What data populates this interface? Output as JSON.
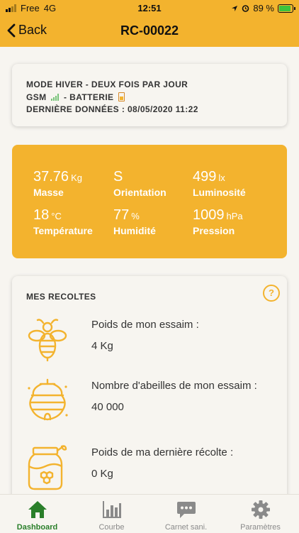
{
  "status_bar": {
    "carrier": "Free",
    "network": "4G",
    "time": "12:51",
    "battery_percent": "89 %",
    "battery_level": 0.89
  },
  "nav": {
    "back_label": "Back",
    "title": "RC-00022"
  },
  "info": {
    "mode": "MODE HIVER - DEUX FOIS PAR JOUR",
    "gsm_label": "GSM",
    "battery_label": "- BATTERIE",
    "last_data": "DERNIÈRE DONNÉES : 08/05/2020 11:22"
  },
  "metrics": [
    {
      "value": "37.76",
      "unit": "Kg",
      "label": "Masse"
    },
    {
      "value": "S",
      "unit": "",
      "label": "Orientation"
    },
    {
      "value": "499",
      "unit": "lx",
      "label": "Luminosité"
    },
    {
      "value": "18",
      "unit": "°C",
      "label": "Température"
    },
    {
      "value": "77",
      "unit": "%",
      "label": "Humidité"
    },
    {
      "value": "1009",
      "unit": "hPa",
      "label": "Pression"
    }
  ],
  "harvests": {
    "title": "MES RECOLTES",
    "help_label": "?",
    "items": [
      {
        "icon": "bee-icon",
        "label": "Poids de mon essaim :",
        "value": "4 Kg"
      },
      {
        "icon": "beehive-icon",
        "label": "Nombre d'abeilles de mon essaim :",
        "value": "40 000"
      },
      {
        "icon": "honey-jar-icon",
        "label": "Poids de ma dernière récolte :",
        "value": "0 Kg"
      }
    ]
  },
  "tabs": [
    {
      "label": "Dashboard",
      "icon": "home-icon",
      "active": true
    },
    {
      "label": "Courbe",
      "icon": "bar-chart-icon",
      "active": false
    },
    {
      "label": "Carnet sani.",
      "icon": "chat-icon",
      "active": false
    },
    {
      "label": "Paramètres",
      "icon": "gear-icon",
      "active": false
    }
  ],
  "colors": {
    "accent": "#f3b32e",
    "tab_active": "#2a7f2a",
    "tab_inactive": "#8a8a8a"
  }
}
